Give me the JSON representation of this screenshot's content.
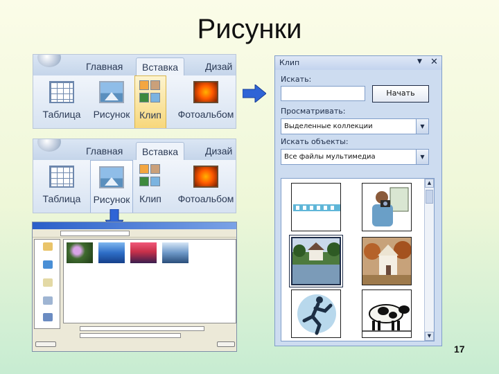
{
  "slide": {
    "title": "Рисунки",
    "number": "17"
  },
  "ribbon_top": {
    "tabs": [
      "Главная",
      "Вставка",
      "Дизай"
    ],
    "active_tab": "Вставка",
    "buttons": [
      "Таблица",
      "Рисунок",
      "Клип",
      "Фотоальбом"
    ],
    "highlighted_button": "Клип"
  },
  "ribbon_bottom": {
    "tabs": [
      "Главная",
      "Вставка",
      "Дизай"
    ],
    "active_tab": "Вставка",
    "buttons": [
      "Таблица",
      "Рисунок",
      "Клип",
      "Фотоальбом"
    ],
    "highlighted_button": "Рисунок"
  },
  "clip_pane": {
    "title": "Клип",
    "dropdown_glyph": "▼",
    "close_glyph": "✕",
    "search_label": "Искать:",
    "search_value": "",
    "go_button": "Начать",
    "browse_label": "Просматривать:",
    "browse_value": "Выделенные коллекции",
    "types_label": "Искать объекты:",
    "types_value": "Все файлы мультимедиа",
    "select_arrow": "▼",
    "scroll_up": "▲",
    "scroll_down": "▼",
    "results": [
      "film-strip-clip",
      "photographer-clip",
      "lake-house-photo",
      "white-house-photo",
      "running-figure-clip",
      "cow-clip"
    ]
  },
  "colors": {
    "ribbon_highlight": "#f7d77a",
    "title_bar": "#2a5fc9",
    "arrow": "#2f64d6",
    "pane_bg": "#cddcf0"
  }
}
